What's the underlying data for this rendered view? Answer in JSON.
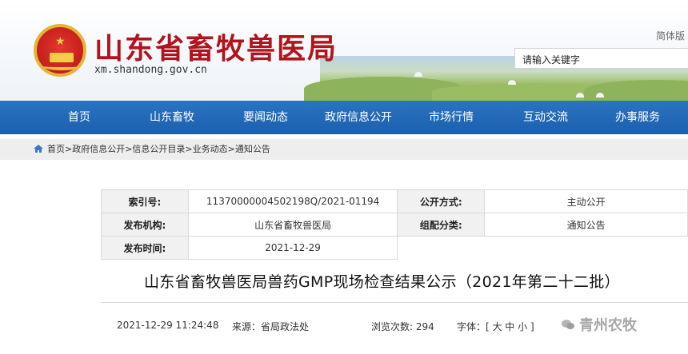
{
  "header": {
    "site_title": "山东省畜牧兽医局",
    "domain": "xm.shandong.gov.cn",
    "lang_link": "简体版",
    "search_placeholder": "请输入关键字"
  },
  "nav": {
    "items": [
      "首页",
      "山东畜牧",
      "要闻动态",
      "政府信息公开",
      "市场行情",
      "互动交流",
      "办事服务"
    ]
  },
  "breadcrumb": {
    "text": "首页>政府信息公开>信息公开目录>业务动态>通知公告"
  },
  "info": {
    "index_label": "索引号:",
    "index_value": "11370000004502198Q/2021-01194",
    "public_mode_label": "公开方式:",
    "public_mode_value": "主动公开",
    "issuer_label": "发布机构:",
    "issuer_value": "山东省畜牧兽医局",
    "category_label": "组配分类:",
    "category_value": "通知公告",
    "date_label": "发布时间:",
    "date_value": "2021-12-29"
  },
  "article": {
    "title": "山东省畜牧兽医局兽药GMP现场检查结果公示（2021年第二十二批）",
    "datetime": "2021-12-29 11:24:48",
    "source": "来源：省局政法处",
    "views": "浏览次数: 294",
    "font_size_label": "字体：[ 大 中 小 ]"
  },
  "watermark": {
    "text": "青州农牧"
  },
  "colors": {
    "nav_blue": "#1c5fae",
    "title_red": "#b0141d"
  }
}
